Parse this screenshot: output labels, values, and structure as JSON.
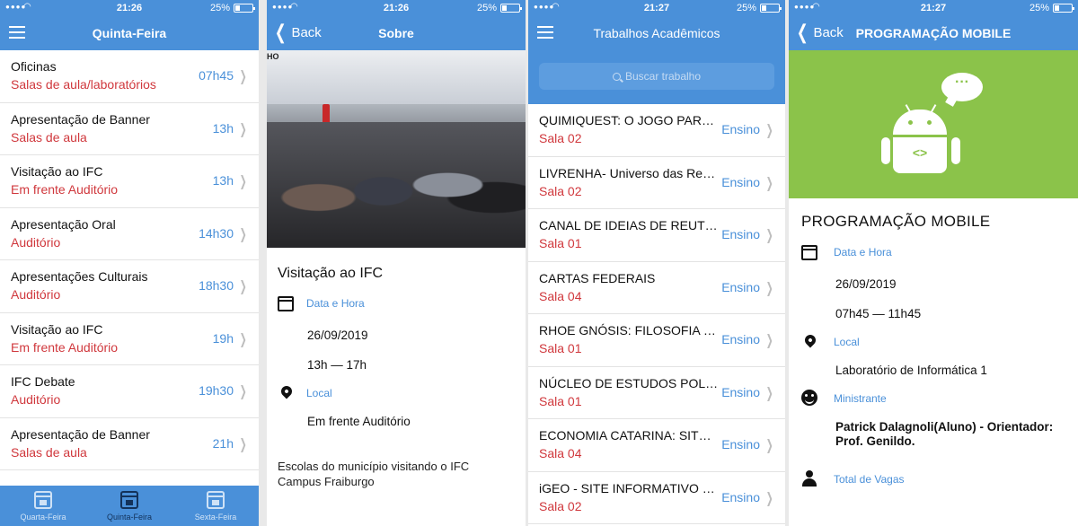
{
  "colors": {
    "primary": "#4a90d9",
    "accent_red": "#d0383d",
    "android_green": "#8bc34a"
  },
  "status": {
    "s1_time": "21:26",
    "s2_time": "21:26",
    "s3_time": "21:27",
    "s4_time": "21:27",
    "battery": "25%"
  },
  "screen1": {
    "title": "Quinta-Feira",
    "items": [
      {
        "title": "Oficinas",
        "place": "Salas de aula/laboratórios",
        "time": "07h45"
      },
      {
        "title": "Apresentação de Banner",
        "place": "Salas de aula",
        "time": "13h"
      },
      {
        "title": "Visitação ao IFC",
        "place": "Em frente Auditório",
        "time": "13h"
      },
      {
        "title": "Apresentação Oral",
        "place": "Auditório",
        "time": "14h30"
      },
      {
        "title": "Apresentações Culturais",
        "place": "Auditório",
        "time": "18h30"
      },
      {
        "title": "Visitação ao IFC",
        "place": "Em frente Auditório",
        "time": "19h"
      },
      {
        "title": "IFC Debate",
        "place": "Auditório",
        "time": "19h30"
      },
      {
        "title": "Apresentação de Banner",
        "place": "Salas de aula",
        "time": "21h"
      }
    ],
    "tabs": [
      {
        "label": "Quarta-Feira",
        "icon": "calendar-icon"
      },
      {
        "label": "Quinta-Feira",
        "icon": "calendar-icon"
      },
      {
        "label": "Sexta-Feira",
        "icon": "calendar-icon"
      }
    ]
  },
  "screen2": {
    "back": "Back",
    "title": "Sobre",
    "photo_sign": "HO",
    "event_title": "Visitação ao IFC",
    "date_label": "Data e Hora",
    "date": "26/09/2019",
    "time": "13h — 17h",
    "local_label": "Local",
    "local": "Em frente Auditório",
    "description": "Escolas do município visitando o IFC Campus Fraiburgo"
  },
  "screen3": {
    "title": "Trabalhos Acadêmicos",
    "search_placeholder": "Buscar trabalho",
    "items": [
      {
        "title": "QUIMIQUEST: O JOGO PARA A...",
        "room": "Sala 02",
        "category": "Ensino"
      },
      {
        "title": "LIVRENHA- Universo das Rese...",
        "room": "Sala 02",
        "category": "Ensino"
      },
      {
        "title": "CANAL DE IDEIAS DE REUTILIZ...",
        "room": "Sala 01",
        "category": "Ensino"
      },
      {
        "title": "CARTAS FEDERAIS",
        "room": "Sala 04",
        "category": "Ensino"
      },
      {
        "title": "RHOE GNÓSIS: FILOSOFIA BÁS...",
        "room": "Sala 01",
        "category": "Ensino"
      },
      {
        "title": "NÚCLEO DE ESTUDOS POLÍTI...",
        "room": "Sala 01",
        "category": "Ensino"
      },
      {
        "title": "ECONOMIA CATARINA: SITE E ...",
        "room": "Sala 04",
        "category": "Ensino"
      },
      {
        "title": "iGEO - SITE INFORMATIVO SO...",
        "room": "Sala 02",
        "category": "Ensino"
      }
    ]
  },
  "screen4": {
    "back": "Back",
    "title": "PROGRAMAÇÃO MOBILE",
    "heading": "PROGRAMAÇÃO MOBILE",
    "date_label": "Data e Hora",
    "date": "26/09/2019",
    "time": "07h45 — 11h45",
    "local_label": "Local",
    "local": "Laboratório de Informática 1",
    "ministrante_label": "Ministrante",
    "ministrante": "Patrick Dalagnoli(Aluno) - Orientador: Prof. Genildo.",
    "vagas_label": "Total de Vagas",
    "code_glyph": "<>",
    "bubble_glyph": "···"
  }
}
